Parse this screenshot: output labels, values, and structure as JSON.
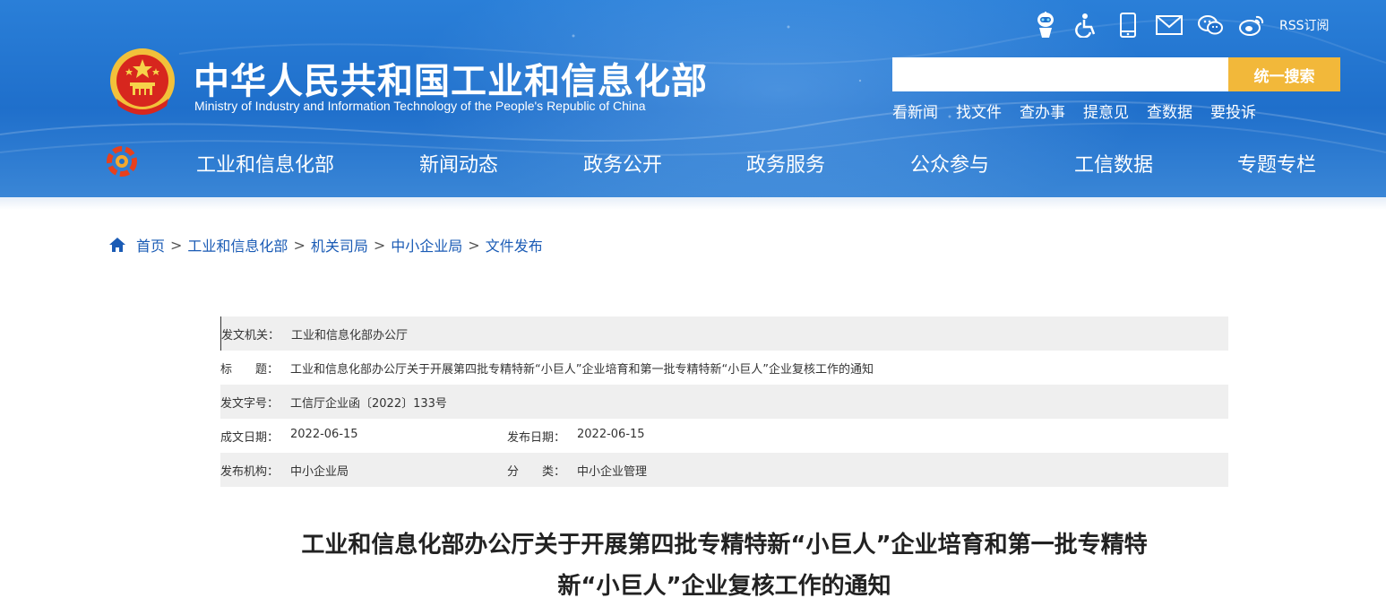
{
  "colors": {
    "header_blue": "#2a7fd8",
    "search_button": "#f2b83a",
    "breadcrumb_link": "#1a5bb5",
    "row_shade": "#efefef"
  },
  "header": {
    "title": "中华人民共和国工业和信息化部",
    "subtitle": "Ministry of Industry and Information Technology of the People's Republic of China",
    "top_icons": [
      "robot-assistant-icon",
      "accessibility-icon",
      "mobile-icon",
      "mail-icon",
      "wechat-icon",
      "weibo-icon"
    ],
    "rss_label": "RSS订阅",
    "search": {
      "value": "",
      "placeholder": "",
      "button_label": "统一搜索"
    },
    "quick_links": [
      "看新闻",
      "找文件",
      "查办事",
      "提意见",
      "查数据",
      "要投诉"
    ]
  },
  "nav": {
    "items": [
      "工业和信息化部",
      "新闻动态",
      "政务公开",
      "政务服务",
      "公众参与",
      "工信数据",
      "专题专栏"
    ]
  },
  "breadcrumb": {
    "items": [
      "首页",
      "工业和信息化部",
      "机关司局",
      "中小企业局",
      "文件发布"
    ],
    "separator": ">"
  },
  "meta": {
    "issuer_label": "发文机关：",
    "issuer": "工业和信息化部办公厅",
    "title_label": "标　　题：",
    "title": "工业和信息化部办公厅关于开展第四批专精特新“小巨人”企业培育和第一批专精特新“小巨人”企业复核工作的通知",
    "doc_no_label": "发文字号：",
    "doc_no": "工信厅企业函〔2022〕133号",
    "created_label": "成文日期：",
    "created": "2022-06-15",
    "published_label": "发布日期：",
    "published": "2022-06-15",
    "org_label": "发布机构：",
    "org": "中小企业局",
    "category_label": "分　　类：",
    "category": "中小企业管理"
  },
  "document": {
    "title_line1": "工业和信息化部办公厅关于开展第四批专精特新“小巨人”企业培育和第一批专精特",
    "title_line2": "新“小巨人”企业复核工作的通知"
  }
}
